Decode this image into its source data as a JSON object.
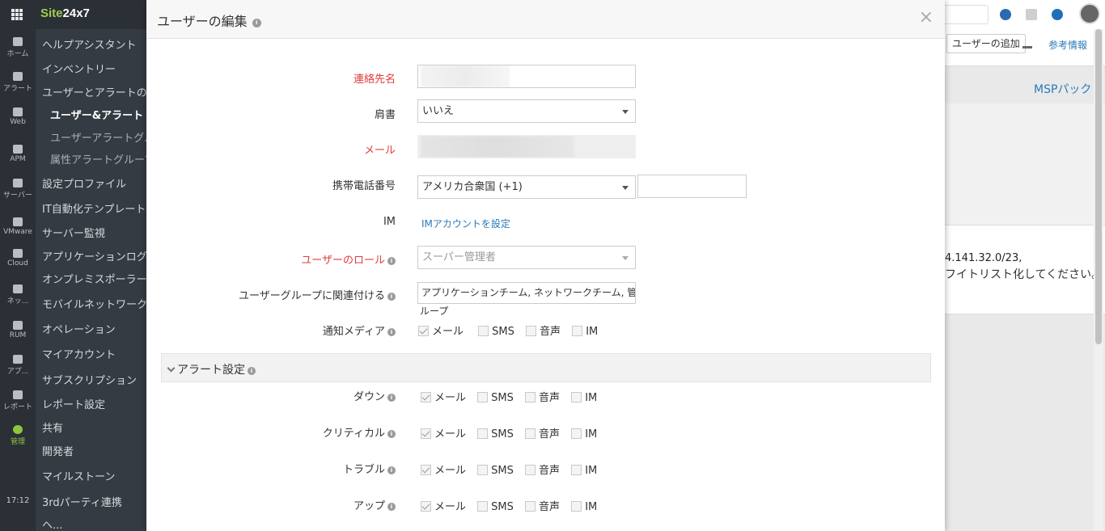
{
  "app": {
    "brand_a": "Site",
    "brand_b": "24x7",
    "time": "17:12",
    "rail": [
      {
        "label": "ホーム",
        "icon": "home-icon"
      },
      {
        "label": "アラート",
        "icon": "bell-icon"
      },
      {
        "label": "Web",
        "icon": "globe-icon"
      },
      {
        "label": "APM",
        "icon": "binoculars-icon"
      },
      {
        "label": "サーバー",
        "icon": "server-icon"
      },
      {
        "label": "VMware",
        "icon": "vmware-icon"
      },
      {
        "label": "Cloud",
        "icon": "cloud-icon"
      },
      {
        "label": "ネッ...",
        "icon": "network-icon"
      },
      {
        "label": "RUM",
        "icon": "rum-globe-icon"
      },
      {
        "label": "アプ...",
        "icon": "app-icon"
      },
      {
        "label": "レポート",
        "icon": "report-icon"
      },
      {
        "label": "管理",
        "icon": "gear-icon"
      }
    ],
    "nav": [
      "ヘルプアシスタント",
      "インベントリー",
      "ユーザーとアラートの管",
      "ユーザー&アラート",
      "ユーザーアラートグル",
      "属性アラートグループ",
      "設定プロファイル",
      "IT自動化テンプレート",
      "サーバー監視",
      "アプリケーションログ",
      "オンプレミスポーラー",
      "モバイルネットワークポ",
      "オペレーション",
      "マイアカウント",
      "サブスクリプション",
      "レポート設定",
      "共有",
      "開発者",
      "マイルストーン",
      "3rdパーティ連携",
      "ヘ..."
    ],
    "toolbar_add_user": "ユーザーの追加",
    "toolbar_ref": "参考情報",
    "msp_link": "MSPパック",
    "bg_ip": "4.141.32.0/23,",
    "bg_whitelist": "フイトリスト化してください。"
  },
  "modal": {
    "title": "ユーザーの編集",
    "close": "×",
    "contact_name_label": "連絡先名",
    "title_field_label": "肩書",
    "title_field_value": "いいえ",
    "email_label": "メール",
    "mobile_label": "携帯電話番号",
    "country_value": "アメリカ合衆国 (+1)",
    "im_label": "IM",
    "im_link": "IMアカウントを設定",
    "role_label": "ユーザーのロール",
    "role_value": "スーパー管理者",
    "group_label": "ユーザーグループに関連付ける",
    "group_value": "アプリケーションチーム, ネットワークチーム, 管理グ",
    "group_value_wrap": "ループ",
    "notify_label": "通知メディア",
    "media": {
      "mail": "メール",
      "sms": "SMS",
      "voice": "音声",
      "im": "IM"
    },
    "alert_section": "アラート設定",
    "alert_rows": [
      {
        "label": "ダウン"
      },
      {
        "label": "クリティカル"
      },
      {
        "label": "トラブル"
      },
      {
        "label": "アップ"
      }
    ]
  }
}
